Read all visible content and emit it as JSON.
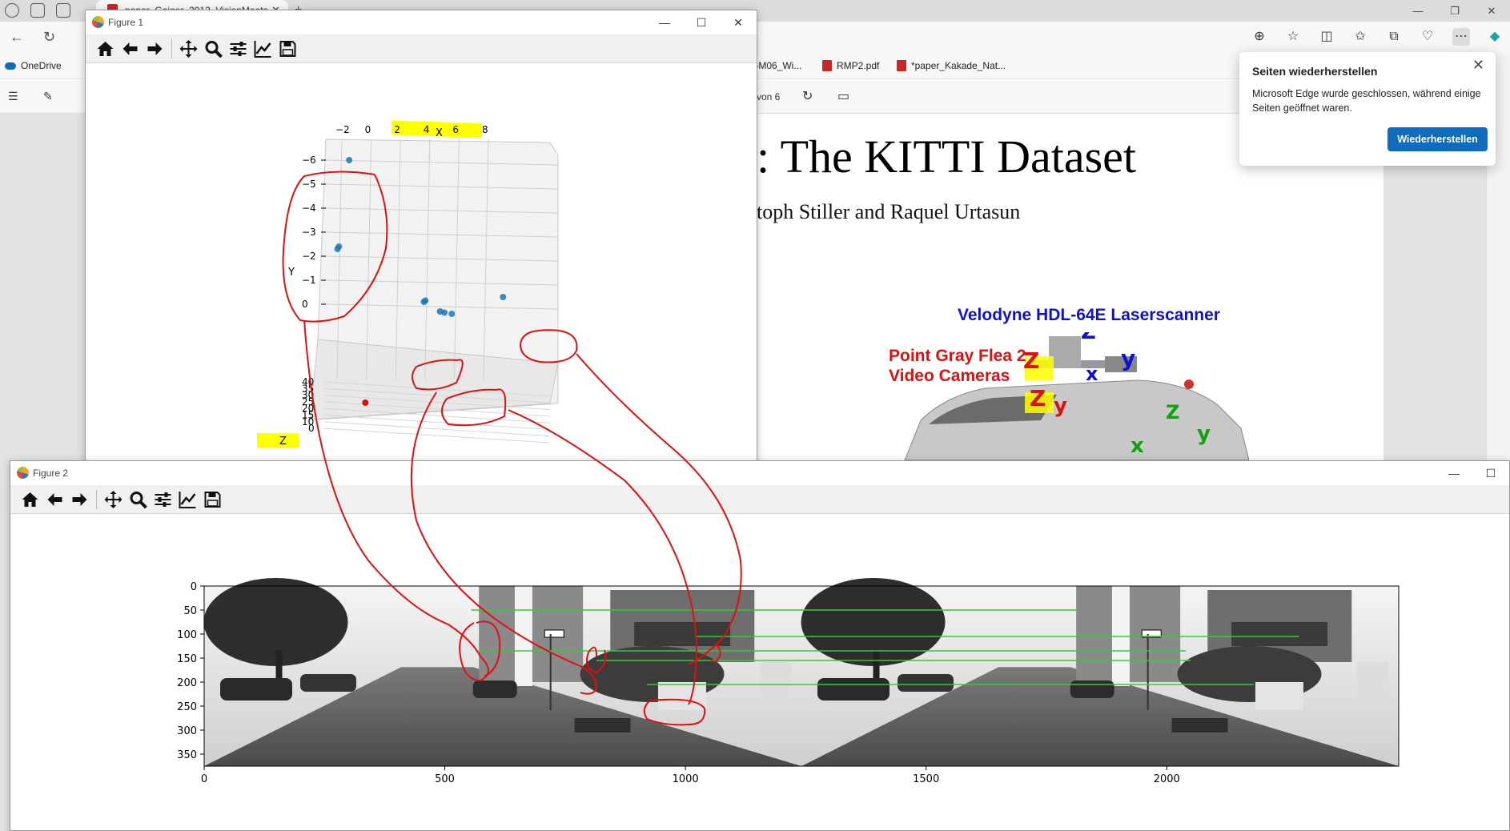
{
  "browser": {
    "tab_title": "paper_Geiger_2013_VisionMeets...",
    "favorites": [
      {
        "label": "OneDrive"
      },
      {
        "label": "PGM06_Wi..."
      },
      {
        "label": "RMP2.pdf"
      },
      {
        "label": "*paper_Kakade_Nat..."
      }
    ],
    "page_counter": "von 6"
  },
  "pdf": {
    "title": ": The KITTI Dataset",
    "authors": "toph Stiller and Raquel Urtasun",
    "velodyne_label": "Velodyne HDL-64E Laserscanner",
    "camera_label_line1": "Point Gray Flea 2",
    "camera_label_line2": "Video Cameras",
    "axis_letters": {
      "z": "Z",
      "x": "X",
      "y": "y",
      "x2": "x",
      "z2": "Z",
      "y2": "y",
      "x3": "x",
      "z3": "Z",
      "y3": "y"
    }
  },
  "popup": {
    "title": "Seiten wiederherstellen",
    "text": "Microsoft Edge wurde geschlossen, während einige Seiten geöffnet waren.",
    "button": "Wiederherstellen"
  },
  "figure1": {
    "window_title": "Figure 1",
    "chart_data": {
      "type": "scatter",
      "title": "",
      "xlabel": "X",
      "ylabel": "Y",
      "zlabel": "Z",
      "x_ticks": [
        "−2",
        "0",
        "2",
        "4",
        "6",
        "8"
      ],
      "y_ticks": [
        "−6",
        "−5",
        "−4",
        "−3",
        "−2",
        "−1",
        "0"
      ],
      "z_ticks": [
        "40",
        "35",
        "30",
        "25",
        "20",
        "15",
        "10",
        "0"
      ],
      "points_blue": [
        {
          "x": -1.5,
          "y": -6.0
        },
        {
          "x": -2.2,
          "y": -2.4
        },
        {
          "x": -2.3,
          "y": -2.3
        },
        {
          "x": 3.6,
          "y": -0.1
        },
        {
          "x": 3.7,
          "y": -0.15
        },
        {
          "x": 4.7,
          "y": 0.3
        },
        {
          "x": 5.0,
          "y": 0.35
        },
        {
          "x": 5.5,
          "y": 0.4
        },
        {
          "x": 9.0,
          "y": -0.3
        }
      ],
      "points_red": [
        {
          "x": -0.4,
          "y": 0.6
        }
      ]
    }
  },
  "figure2": {
    "window_title": "Figure 2",
    "chart_data": {
      "type": "image",
      "x_ticks": [
        "0",
        "500",
        "1000",
        "1500",
        "2000"
      ],
      "y_ticks": [
        "0",
        "50",
        "100",
        "150",
        "200",
        "250",
        "300",
        "350"
      ],
      "xlim": [
        0,
        2482
      ],
      "ylim": [
        375,
        0
      ],
      "match_lines_y": [
        50,
        105,
        135,
        155,
        205
      ]
    }
  },
  "colors": {
    "match_line": "#33cc33",
    "annotation": "#e01010",
    "highlight": "#ffff00",
    "scatter_blue": "#1f77b4",
    "scatter_red": "#e01010"
  }
}
